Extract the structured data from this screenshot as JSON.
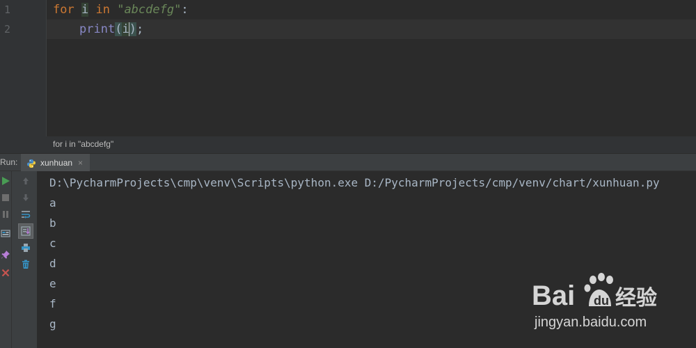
{
  "editor": {
    "line_numbers": [
      "1",
      "2"
    ],
    "line1": {
      "kw_for": "for",
      "var_i": "i",
      "kw_in": "in",
      "string": "\"abcdefg\"",
      "colon": ":"
    },
    "line2": {
      "func": "print",
      "open_paren": "(",
      "arg": "i",
      "close_paren": ")",
      "semicolon": ";"
    }
  },
  "breadcrumb": {
    "text": "for i in \"abcdefg\""
  },
  "run_panel": {
    "label": "Run:",
    "tab": {
      "name": "xunhuan",
      "close": "×",
      "icon": "python-icon"
    },
    "left_tools": [
      "run-icon",
      "stop-icon",
      "pause-icon",
      "layout-icon",
      "pin-icon",
      "close-icon"
    ],
    "right_tools": [
      "up-arrow-icon",
      "down-arrow-icon",
      "soft-wrap-icon",
      "scroll-to-end-icon",
      "print-icon",
      "trash-icon"
    ]
  },
  "console": {
    "command": "D:\\PycharmProjects\\cmp\\venv\\Scripts\\python.exe D:/PycharmProjects/cmp/venv/chart/xunhuan.py",
    "outputs": [
      "a",
      "b",
      "c",
      "d",
      "e",
      "f",
      "g"
    ]
  },
  "watermark": {
    "brand": "Bai du 经验",
    "url": "jingyan.baidu.com"
  },
  "colors": {
    "keyword": "#cc7832",
    "string": "#6a8759",
    "builtin": "#8888c6",
    "text": "#a9b7c6",
    "background": "#2b2b2b",
    "run_green": "#499c54",
    "close_red": "#c75450"
  }
}
